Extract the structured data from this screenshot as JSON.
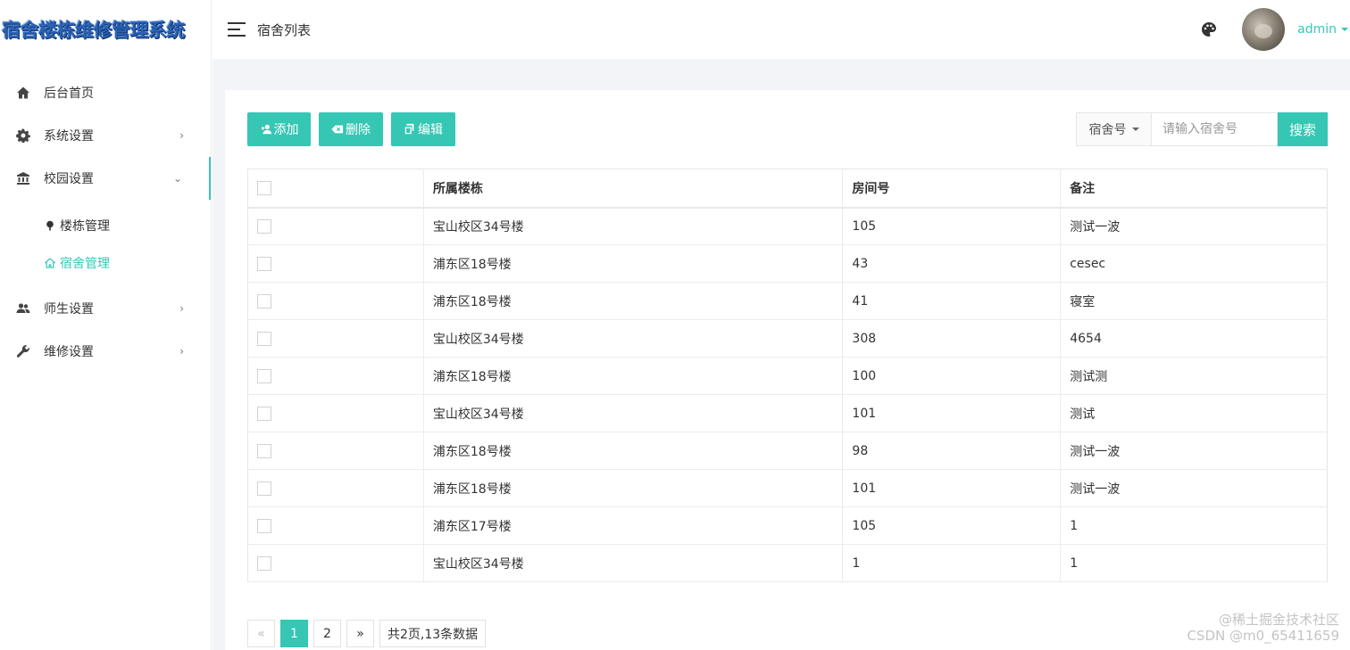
{
  "app": {
    "title": "宿舍楼栋维修管理系统"
  },
  "header": {
    "page_title": "宿舍列表",
    "user_name": "admin"
  },
  "sidebar": {
    "items": [
      {
        "label": "后台首页",
        "icon": "home-icon"
      },
      {
        "label": "系统设置",
        "icon": "gear-icon"
      },
      {
        "label": "校园设置",
        "icon": "bank-icon"
      },
      {
        "label": "师生设置",
        "icon": "people-icon"
      },
      {
        "label": "维修设置",
        "icon": "wrench-icon"
      }
    ],
    "sub_items": [
      {
        "label": "楼栋管理",
        "icon": "pin-icon"
      },
      {
        "label": "宿舍管理",
        "icon": "house-icon"
      }
    ]
  },
  "toolbar": {
    "add_label": "添加",
    "delete_label": "删除",
    "edit_label": "编辑",
    "search_field": "宿舍号",
    "search_placeholder": "请输入宿舍号",
    "search_label": "搜索"
  },
  "table": {
    "columns": [
      "所属楼栋",
      "房间号",
      "备注"
    ],
    "rows": [
      [
        "宝山校区34号楼",
        "105",
        "测试一波"
      ],
      [
        "浦东区18号楼",
        "43",
        "cesec"
      ],
      [
        "浦东区18号楼",
        "41",
        "寝室"
      ],
      [
        "宝山校区34号楼",
        "308",
        "4654"
      ],
      [
        "浦东区18号楼",
        "100",
        "测试测"
      ],
      [
        "宝山校区34号楼",
        "101",
        "测试"
      ],
      [
        "浦东区18号楼",
        "98",
        "测试一波"
      ],
      [
        "浦东区18号楼",
        "101",
        "测试一波"
      ],
      [
        "浦东区17号楼",
        "105",
        "1"
      ],
      [
        "宝山校区34号楼",
        "1",
        "1"
      ]
    ]
  },
  "pagination": {
    "prev": "«",
    "pages": [
      "1",
      "2"
    ],
    "current_page": "1",
    "next": "»",
    "info": "共2页,13条数据"
  },
  "watermark": {
    "line1": "@稀土掘金技术社区",
    "line2": "CSDN @m0_65411659"
  },
  "colors": {
    "accent": "#36c6b4",
    "content_bg": "#f3f4f8"
  }
}
